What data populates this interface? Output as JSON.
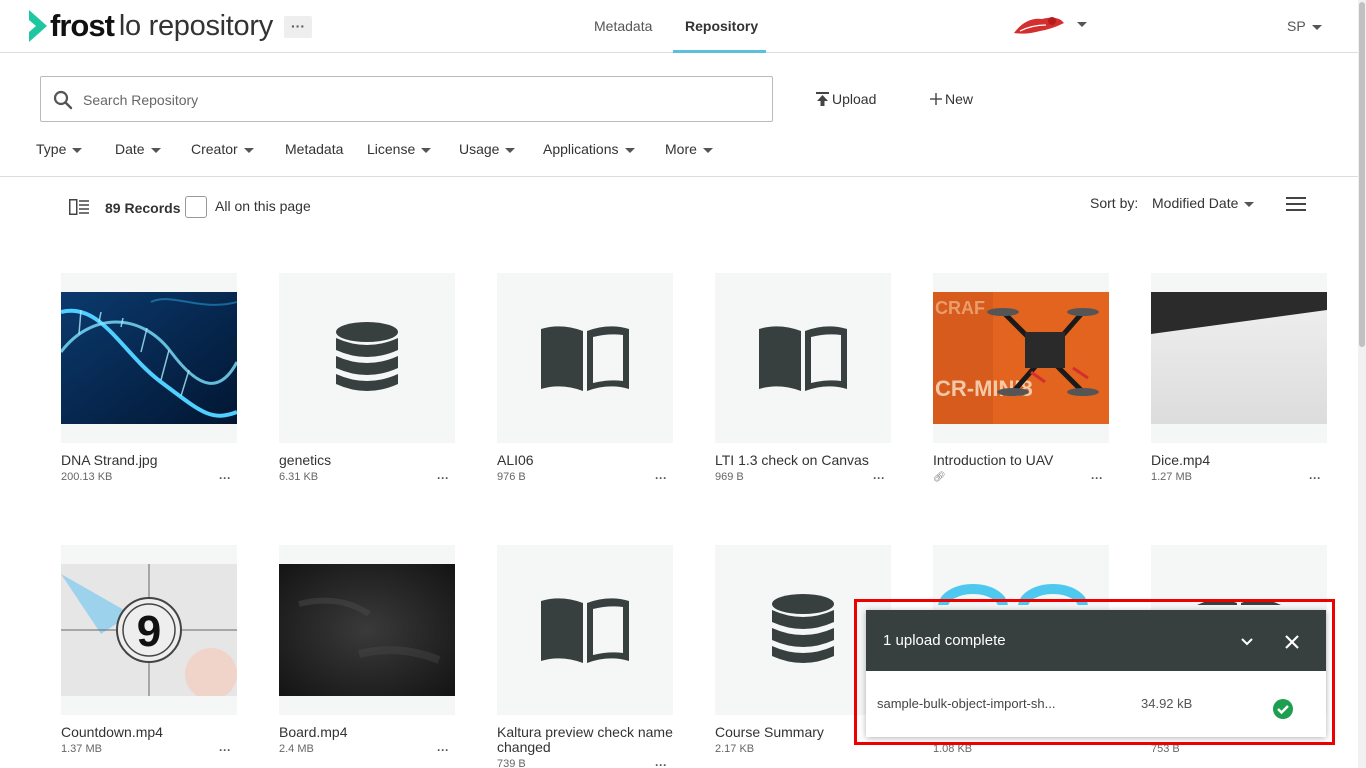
{
  "header": {
    "logo_bold": "frost",
    "logo_light": "lo repository",
    "more_label": "···",
    "tabs": [
      {
        "label": "Metadata"
      },
      {
        "label": "Repository"
      }
    ],
    "user": "SP"
  },
  "search": {
    "placeholder": "Search Repository",
    "value": ""
  },
  "actions": {
    "upload": "Upload",
    "new": "New"
  },
  "filters": [
    "Type",
    "Date",
    "Creator",
    "Metadata",
    "License",
    "Usage",
    "Applications",
    "More"
  ],
  "records": {
    "count": "89 Records",
    "select_all": "All on this page",
    "sort_label": "Sort by:",
    "sort_value": "Modified Date"
  },
  "items": [
    {
      "title": "DNA Strand.jpg",
      "size": "200.13 KB",
      "thumb": "image-dna"
    },
    {
      "title": "genetics",
      "size": "6.31 KB",
      "thumb": "database-icon"
    },
    {
      "title": "ALI06",
      "size": "976 B",
      "thumb": "book-icon"
    },
    {
      "title": "LTI 1.3 check on Canvas",
      "size": "969 B",
      "thumb": "book-icon"
    },
    {
      "title": "Introduction to UAV",
      "size": "",
      "thumb": "image-drone"
    },
    {
      "title": "Dice.mp4",
      "size": "1.27 MB",
      "thumb": "video-dice"
    },
    {
      "title": "Countdown.mp4",
      "size": "1.37 MB",
      "thumb": "video-countdown"
    },
    {
      "title": "Board.mp4",
      "size": "2.4 MB",
      "thumb": "video-board"
    },
    {
      "title": "Kaltura preview check name changed",
      "size": "739 B",
      "thumb": "book-icon"
    },
    {
      "title": "Course Summary",
      "size": "2.17 KB",
      "thumb": "database-icon"
    },
    {
      "title": "...",
      "size": "1.08 KB",
      "thumb": "partial"
    },
    {
      "title": "...",
      "size": "753 B",
      "thumb": "partial"
    }
  ],
  "more_label": "···",
  "countdown_number": "9",
  "upload": {
    "title": "1 upload complete",
    "file_name": "sample-bulk-object-import-sh...",
    "file_size": "34.92 kB",
    "status": "complete"
  },
  "colors": {
    "accent": "#5bc0de",
    "logo_green": "#1fc7a0",
    "panel_dark": "#37403f",
    "success": "#1e9e50",
    "highlight": "#e00000"
  }
}
